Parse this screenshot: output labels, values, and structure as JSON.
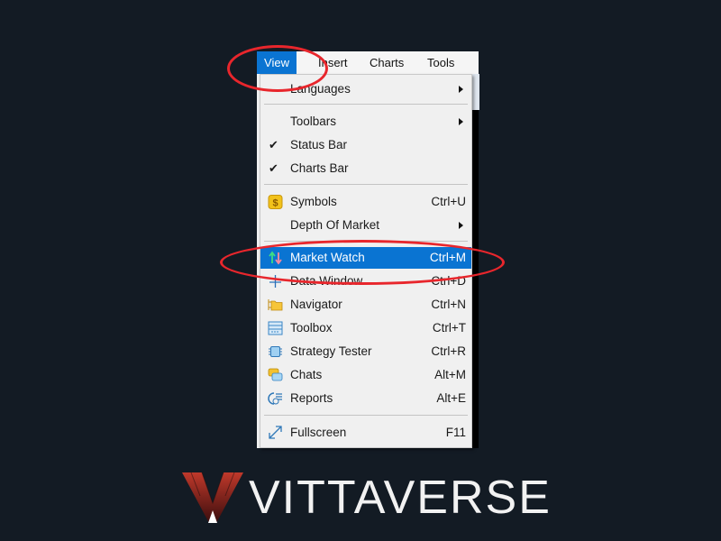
{
  "menubar": {
    "items": [
      {
        "label": "View",
        "active": true
      },
      {
        "label": "Insert"
      },
      {
        "label": "Charts"
      },
      {
        "label": "Tools"
      }
    ]
  },
  "view_menu": {
    "items": [
      {
        "label": "Languages",
        "submenu": true
      },
      {
        "label": "Toolbars",
        "submenu": true
      },
      {
        "label": "Status Bar",
        "checked": true
      },
      {
        "label": "Charts Bar",
        "checked": true
      },
      {
        "label": "Symbols",
        "shortcut": "Ctrl+U",
        "icon": "dollar-icon"
      },
      {
        "label": "Depth Of Market",
        "submenu": true
      },
      {
        "label": "Market Watch",
        "shortcut": "Ctrl+M",
        "icon": "up-down-arrows-icon",
        "highlighted": true
      },
      {
        "label": "Data Window",
        "shortcut": "Ctrl+D",
        "icon": "crosshair-icon"
      },
      {
        "label": "Navigator",
        "shortcut": "Ctrl+N",
        "icon": "folder-icon"
      },
      {
        "label": "Toolbox",
        "shortcut": "Ctrl+T",
        "icon": "toolbox-icon"
      },
      {
        "label": "Strategy Tester",
        "shortcut": "Ctrl+R",
        "icon": "chip-icon"
      },
      {
        "label": "Chats",
        "shortcut": "Alt+M",
        "icon": "chat-bubbles-icon"
      },
      {
        "label": "Reports",
        "shortcut": "Alt+E",
        "icon": "reports-icon"
      },
      {
        "label": "Fullscreen",
        "shortcut": "F11",
        "icon": "expand-icon"
      }
    ]
  },
  "annotation_color": "#e8262c",
  "highlight_color": "#0a74d2",
  "logo": {
    "text": "VITTAVERSE"
  }
}
